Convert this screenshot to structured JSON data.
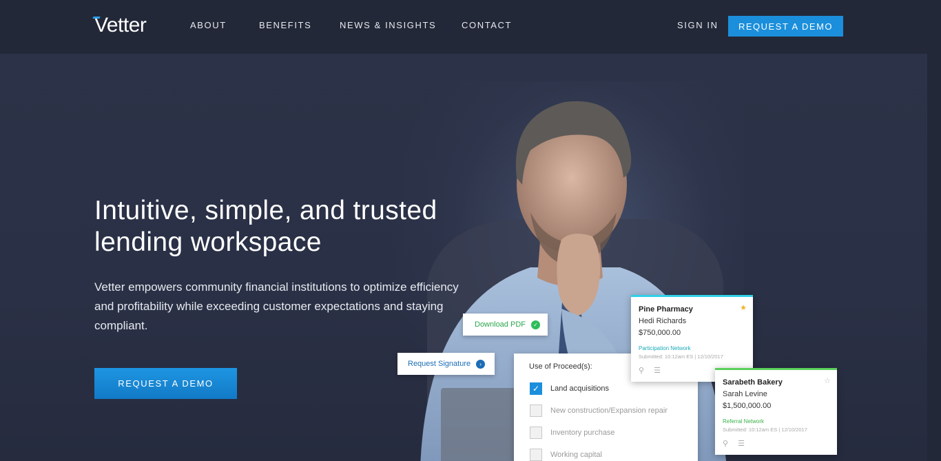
{
  "nav": {
    "logo": "Vetter",
    "links": [
      "ABOUT",
      "BENEFITS",
      "NEWS & INSIGHTS",
      "CONTACT"
    ],
    "sign_in": "SIGN IN",
    "cta": "REQUEST A DEMO"
  },
  "hero": {
    "headline_line1": "Intuitive, simple, and trusted",
    "headline_line2": "lending workspace",
    "subtext": "Vetter empowers community financial institutions to optimize efficiency and profitability while exceeding customer expectations and staying compliant.",
    "cta": "REQUEST A DEMO"
  },
  "widgets": {
    "download_pdf": "Download PDF",
    "request_signature": "Request Signature",
    "proceeds": {
      "title": "Use of Proceed(s):",
      "options": [
        {
          "label": "Land acquisitions",
          "checked": true
        },
        {
          "label": "New construction/Expansion repair",
          "checked": false
        },
        {
          "label": "Inventory purchase",
          "checked": false
        },
        {
          "label": "Working capital",
          "checked": false
        }
      ]
    },
    "cards": [
      {
        "business": "Pine Pharmacy",
        "contact": "Hedi Richards",
        "amount": "$750,000.00",
        "network": "Participation Network",
        "submitted": "Submitted: 10:12am ES | 12/10/2017",
        "starred": true
      },
      {
        "business": "Sarabeth Bakery",
        "contact": "Sarah Levine",
        "amount": "$1,500,000.00",
        "network": "Referral Network",
        "submitted": "Submitted: 10:12am ES | 12/10/2017",
        "starred": false
      }
    ]
  },
  "colors": {
    "background": "#2a3045",
    "nav_background": "#232838",
    "accent": "#1b8fdc",
    "pine_accent": "#2fd0e8",
    "sarabeth_accent": "#5ad05a"
  }
}
